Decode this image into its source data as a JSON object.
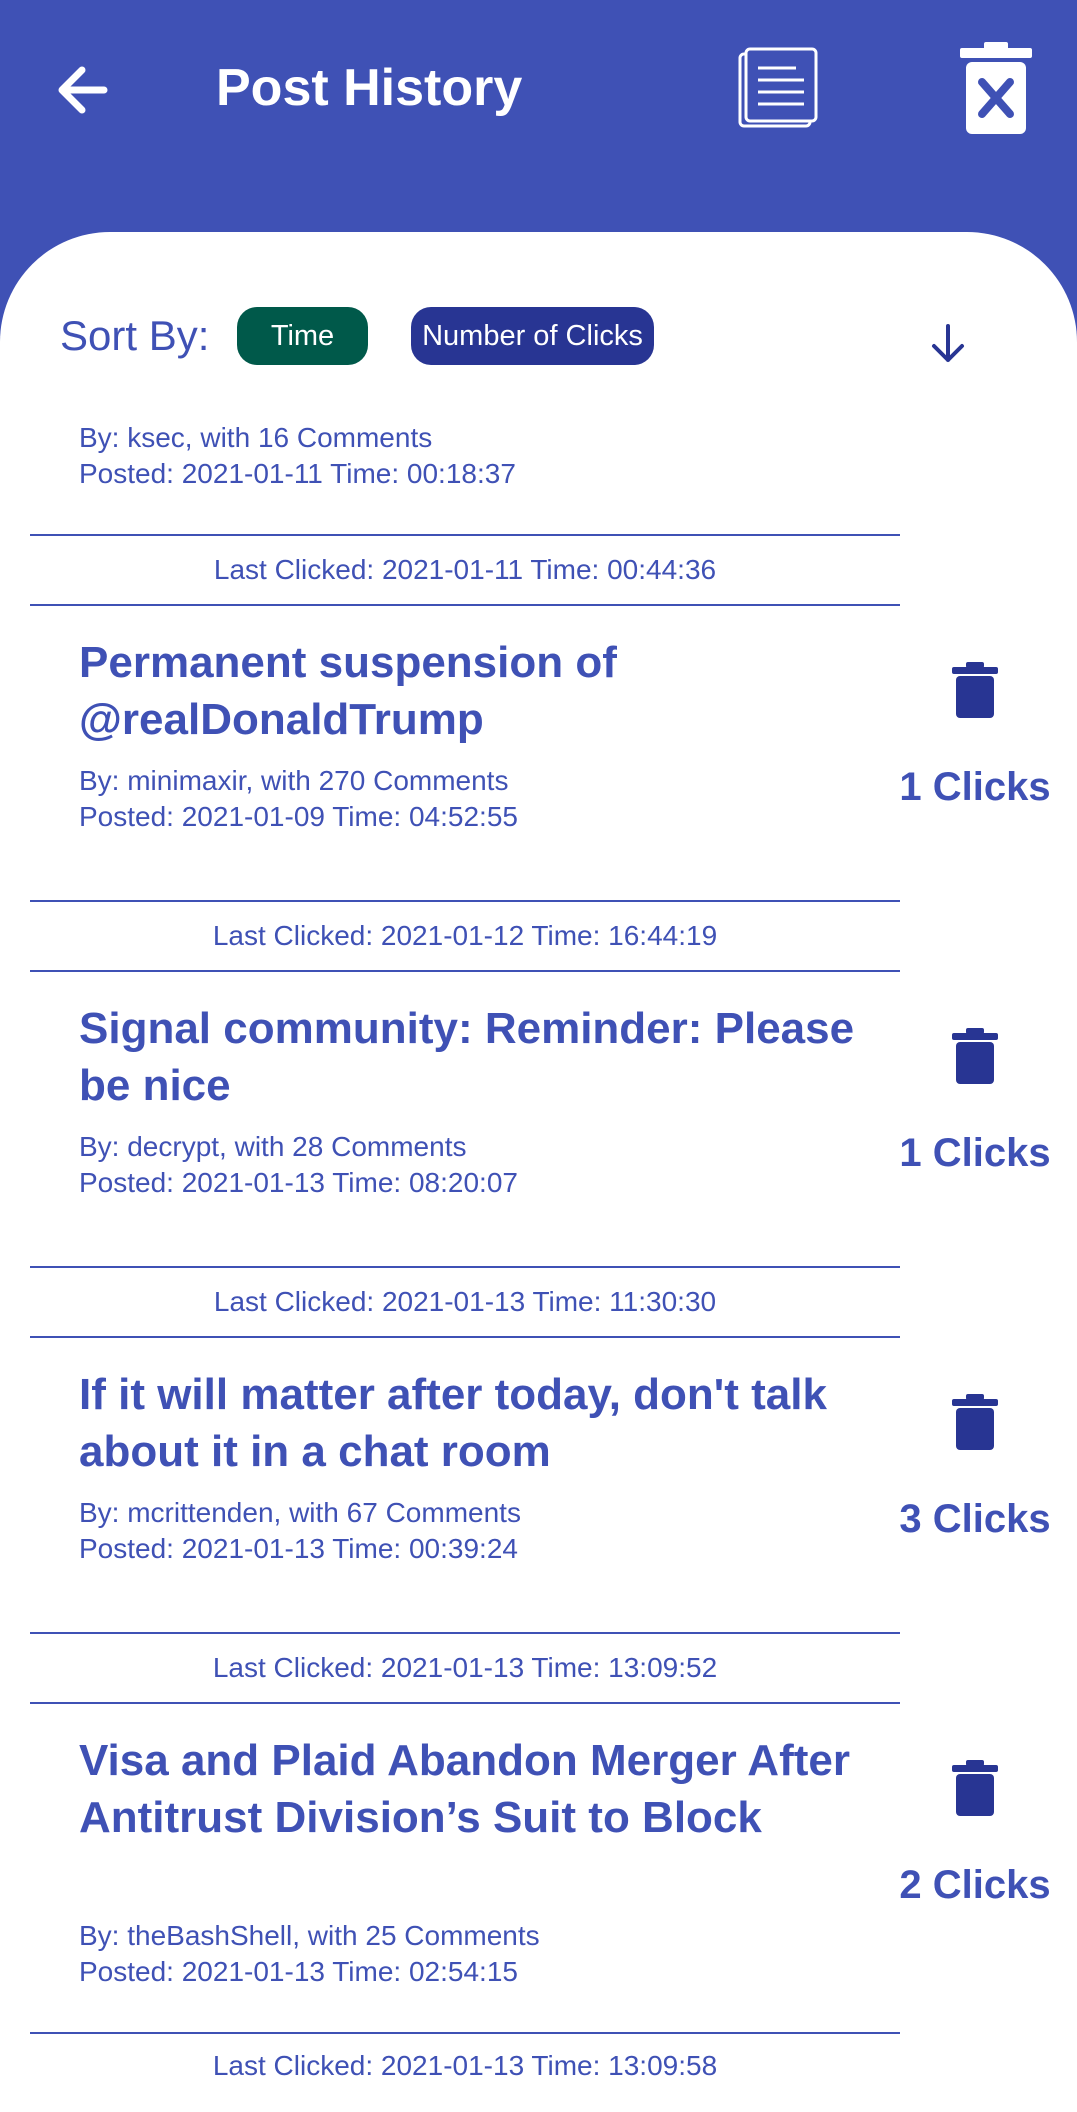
{
  "appbar": {
    "title": "Post History",
    "icons": [
      "back-arrow-icon",
      "list-icon",
      "delete-all-icon"
    ]
  },
  "sort": {
    "label": "Sort By:",
    "options": [
      "Time",
      "Number of Clicks"
    ],
    "direction_icon": "arrow-down-icon"
  },
  "colors": {
    "primary": "#3f51b5",
    "chip_time": "#00594a",
    "chip_clicks": "#283593",
    "trash": "#283593"
  },
  "posts": [
    {
      "title": "",
      "meta_by": "By: ksec, with 16 Comments",
      "meta_posted": "Posted: 2021-01-11 Time: 00:18:37",
      "last_clicked": "Last Clicked: 2021-01-11 Time: 00:44:36"
    },
    {
      "title": "Permanent suspension of @realDonaldTrump",
      "meta_by": "By: minimaxir, with 270 Comments",
      "meta_posted": "Posted: 2021-01-09 Time: 04:52:55",
      "clicks": "1 Clicks",
      "last_clicked": "Last Clicked: 2021-01-12 Time: 16:44:19"
    },
    {
      "title": "Signal community: Reminder: Please be nice",
      "meta_by": "By: decrypt, with 28 Comments",
      "meta_posted": "Posted: 2021-01-13 Time: 08:20:07",
      "clicks": "1 Clicks",
      "last_clicked": "Last Clicked: 2021-01-13 Time: 11:30:30"
    },
    {
      "title": "If it will matter after today, don't talk about it in a chat room",
      "meta_by": "By: mcrittenden, with 67 Comments",
      "meta_posted": "Posted: 2021-01-13 Time: 00:39:24",
      "clicks": "3 Clicks",
      "last_clicked": "Last Clicked: 2021-01-13 Time: 13:09:52"
    },
    {
      "title": "Visa and Plaid Abandon Merger After Antitrust Division’s Suit to Block",
      "meta_by": "By: theBashShell, with 25 Comments",
      "meta_posted": "Posted: 2021-01-13 Time: 02:54:15",
      "clicks": "2 Clicks",
      "last_clicked": "Last Clicked: 2021-01-13 Time: 13:09:58"
    }
  ]
}
